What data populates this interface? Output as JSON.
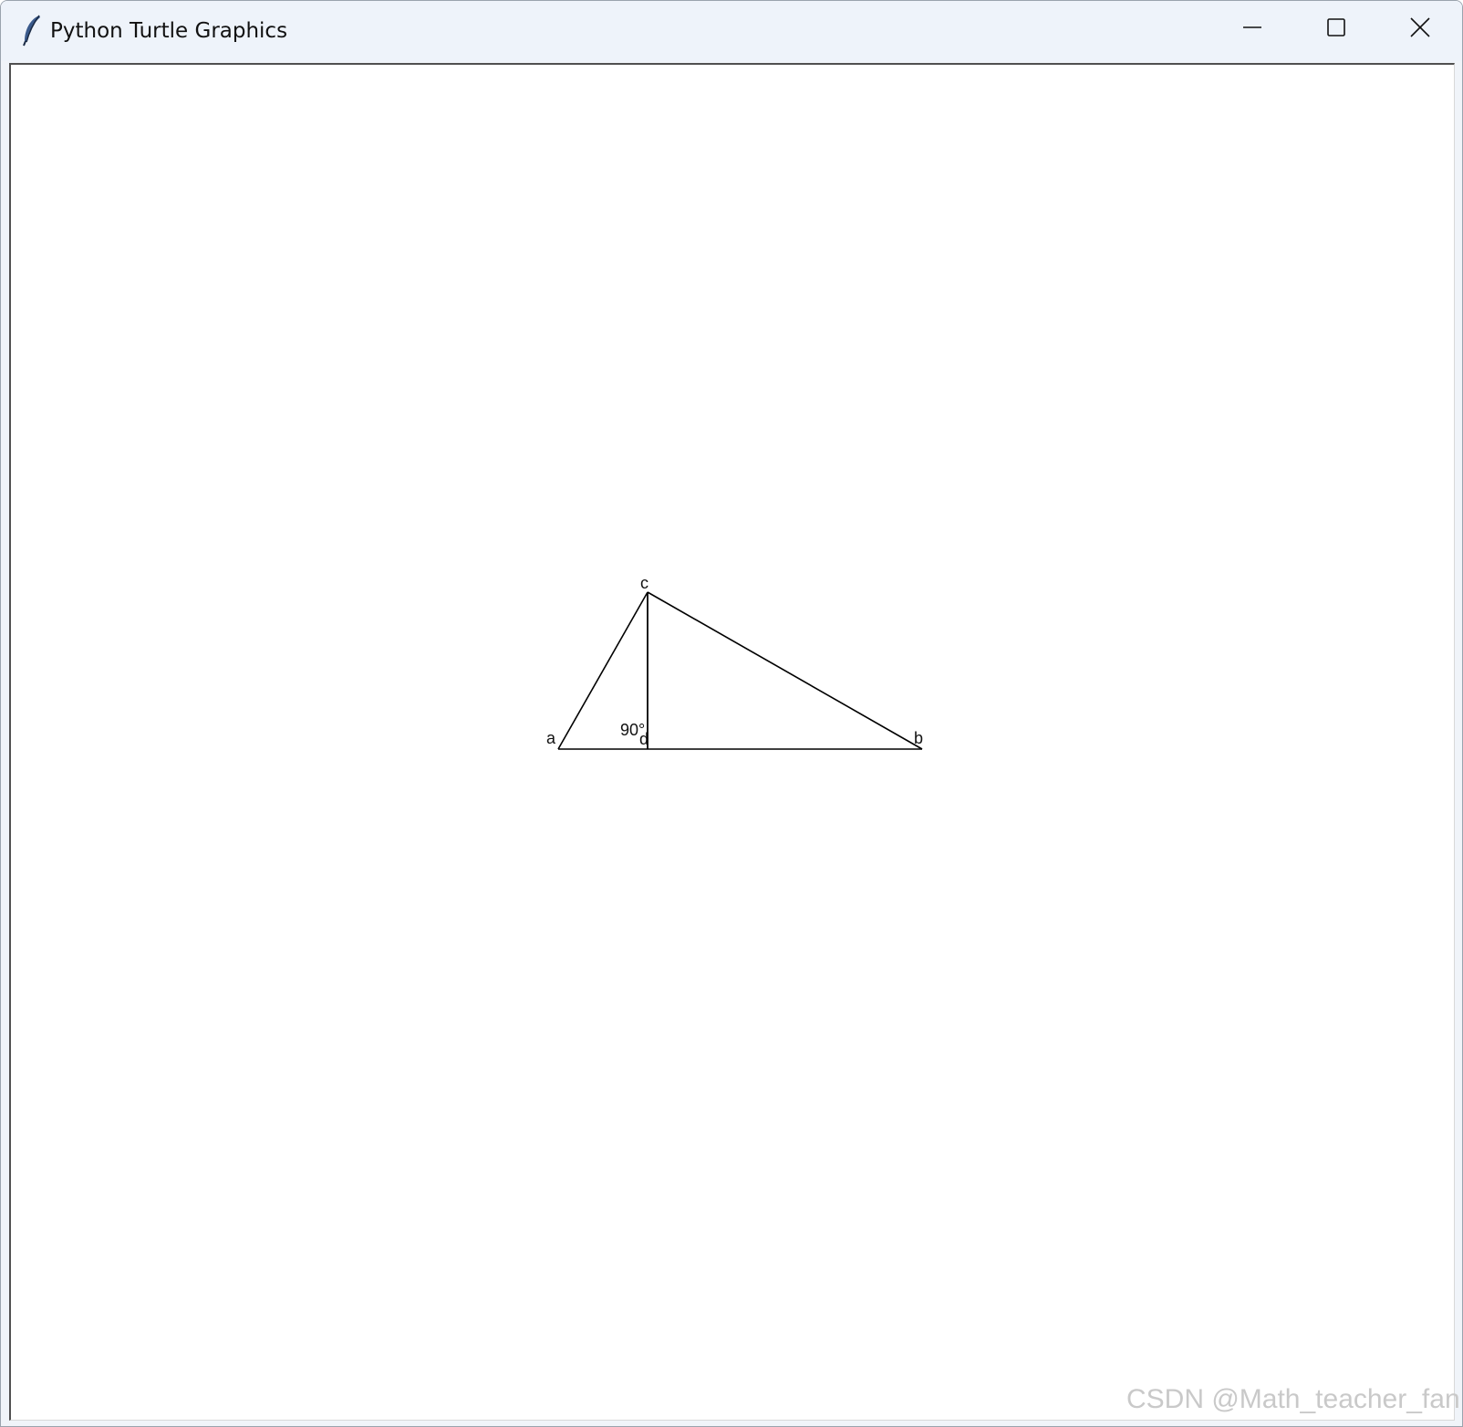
{
  "window": {
    "title": "Python Turtle Graphics",
    "app_icon": "feather-icon",
    "controls": {
      "minimize_icon": "minimize-icon",
      "maximize_icon": "maximize-icon",
      "close_icon": "close-icon"
    }
  },
  "canvas": {
    "background": "#ffffff",
    "stroke_color": "#000000",
    "labels": {
      "a": "a",
      "b": "b",
      "c": "c",
      "d": "d",
      "angle": "90°"
    }
  },
  "watermark": "CSDN @Math_teacher_fan"
}
